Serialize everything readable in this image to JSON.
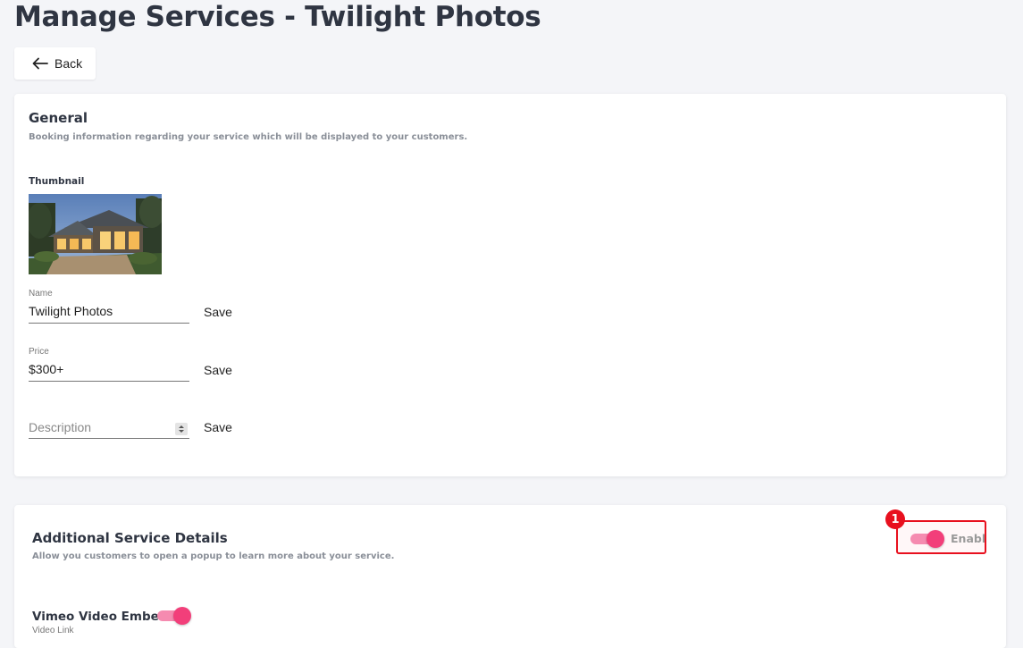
{
  "page": {
    "title": "Manage Services - Twilight Photos"
  },
  "back_button": {
    "label": "Back"
  },
  "general": {
    "title": "General",
    "subtitle": "Booking information regarding your service which will be displayed to your customers.",
    "thumbnail_label": "Thumbnail",
    "fields": {
      "name": {
        "label": "Name",
        "value": "Twilight Photos",
        "save_label": "Save"
      },
      "price": {
        "label": "Price",
        "value": "$300+",
        "save_label": "Save"
      },
      "description": {
        "placeholder": "Description",
        "save_label": "Save"
      }
    }
  },
  "additional": {
    "title": "Additional Service Details",
    "subtitle": "Allow you customers to open a popup to learn more about your service.",
    "enable_toggle": {
      "label": "Enable",
      "on": true
    },
    "annotation_badge": "1",
    "vimeo": {
      "title": "Vimeo Video Embed",
      "on": true,
      "video_link_label": "Video Link"
    }
  },
  "colors": {
    "accent": "#f23f7a",
    "accent_track": "#f58bb0",
    "highlight": "#e8101e",
    "title": "#2f3542",
    "background": "#f4f5f8"
  }
}
